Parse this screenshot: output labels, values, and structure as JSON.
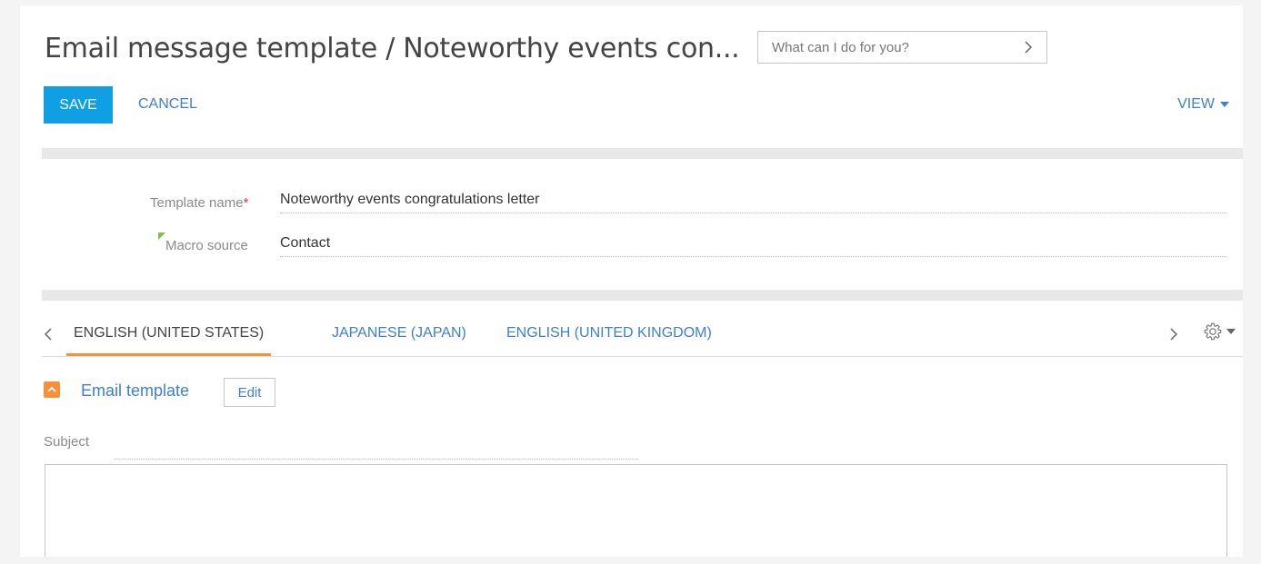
{
  "header": {
    "title": "Email message template / Noteworthy events con...",
    "search_placeholder": "What can I do for you?"
  },
  "toolbar": {
    "save_label": "SAVE",
    "cancel_label": "CANCEL",
    "view_label": "VIEW"
  },
  "fields": {
    "template_name_label": "Template name",
    "template_name_required": "*",
    "template_name_value": "Noteworthy events congratulations letter",
    "macro_source_label": "Macro source",
    "macro_source_value": "Contact"
  },
  "tabs": [
    {
      "label": "ENGLISH (UNITED STATES)",
      "active": true
    },
    {
      "label": "JAPANESE (JAPAN)",
      "active": false
    },
    {
      "label": "ENGLISH (UNITED KINGDOM)",
      "active": false
    }
  ],
  "email_template": {
    "group_title": "Email template",
    "edit_label": "Edit",
    "subject_label": "Subject"
  },
  "colors": {
    "accent": "#0ea0e2",
    "link": "#3f7fd0",
    "tab_active_underline": "#f5913b",
    "required": "#ee3333",
    "macro_flag": "#7bc142"
  },
  "icons": {
    "search_chevron": "chevron-right-icon",
    "view_caret": "caret-down-icon",
    "tabs_left": "chevron-left-icon",
    "tabs_right": "chevron-right-icon",
    "tabs_settings": "gear-icon",
    "group_toggle": "chevron-up-icon"
  }
}
